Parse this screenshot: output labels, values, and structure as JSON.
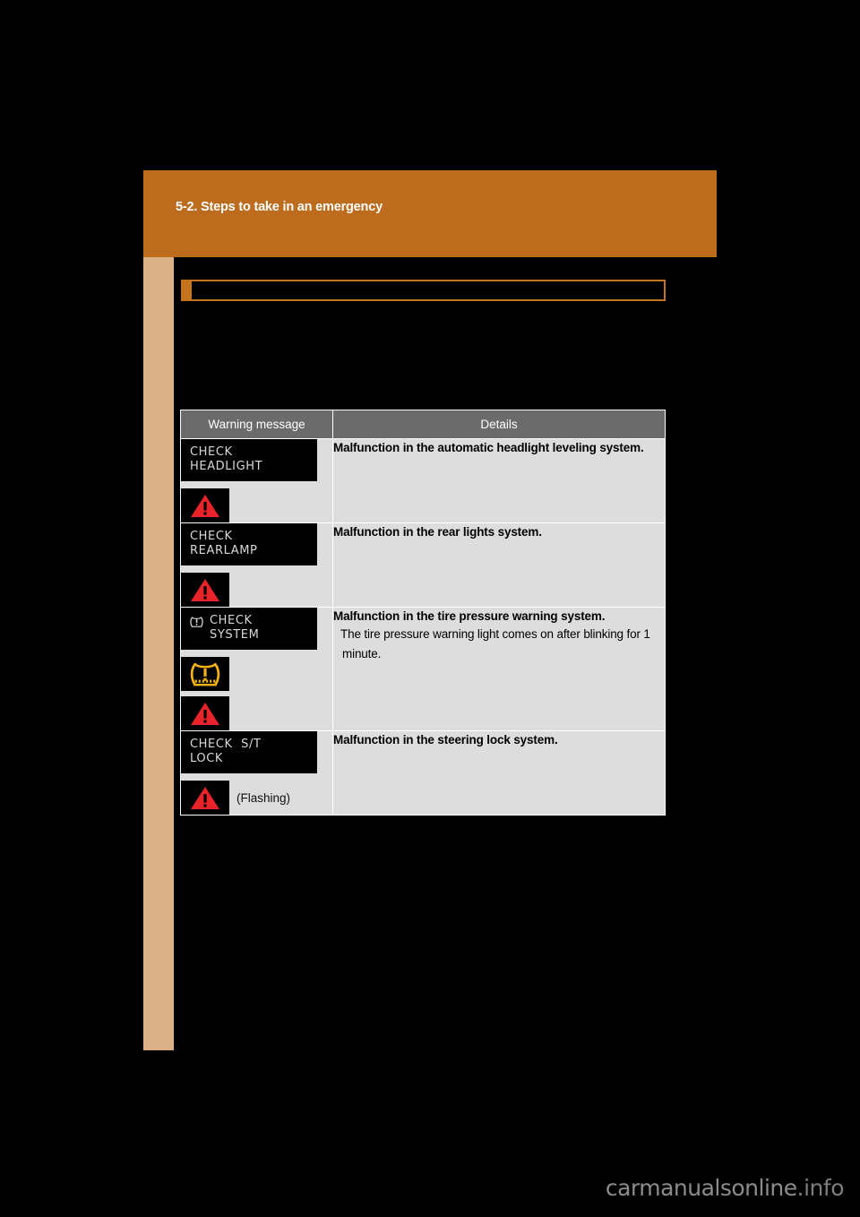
{
  "page": {
    "background_color": "#000000",
    "sheet_color": "#000000",
    "accent_orange": "#bd6b1d",
    "accent_orange_border": "#c4731f",
    "side_tab_color": "#dcb188"
  },
  "header": {
    "chapter_title": "5-2. Steps to take in an emergency"
  },
  "section_heading": {
    "text": ""
  },
  "table": {
    "columns": [
      {
        "key": "message",
        "label": "Warning message"
      },
      {
        "key": "details",
        "label": "Details"
      }
    ],
    "header_bg": "#6b6b6b",
    "cell_bg": "#dddddd",
    "rows": [
      {
        "lcd_lines": [
          "CHECK",
          "HEADLIGHT"
        ],
        "lcd_icon": null,
        "indicators": [
          "master-warning-triangle-icon"
        ],
        "indicator_note": "",
        "details_main": "Malfunction in the automatic headlight leveling system.",
        "details_sub": ""
      },
      {
        "lcd_lines": [
          "CHECK",
          "REARLAMP"
        ],
        "lcd_icon": null,
        "indicators": [
          "master-warning-triangle-icon"
        ],
        "indicator_note": "",
        "details_main": "Malfunction in the rear lights system.",
        "details_sub": ""
      },
      {
        "lcd_lines": [
          "CHECK",
          "SYSTEM"
        ],
        "lcd_icon": "tire-pressure-warning-icon",
        "indicators": [
          "tire-pressure-warning-icon",
          "master-warning-triangle-icon"
        ],
        "indicator_note": "",
        "details_main": "Malfunction in the tire pressure warning system.",
        "details_sub": "The tire pressure warning light comes on after blinking for 1 minute."
      },
      {
        "lcd_lines": [
          "CHECK  S/T",
          "LOCK"
        ],
        "lcd_icon": null,
        "indicators": [
          "master-warning-triangle-icon"
        ],
        "indicator_note": "(Flashing)",
        "details_main": "Malfunction in the steering lock system.",
        "details_sub": ""
      }
    ]
  },
  "icons": {
    "master_warning_triangle": {
      "name": "master-warning-triangle-icon",
      "fill": "#e8232a",
      "mark": "#000000",
      "background": "#000000"
    },
    "tire_pressure_warning": {
      "name": "tire-pressure-warning-icon",
      "stroke": "#f2b213",
      "background": "#000000"
    }
  },
  "watermark": {
    "text": "carmanualsonline",
    "suffix": ".info",
    "color": "#8c8c8c"
  }
}
